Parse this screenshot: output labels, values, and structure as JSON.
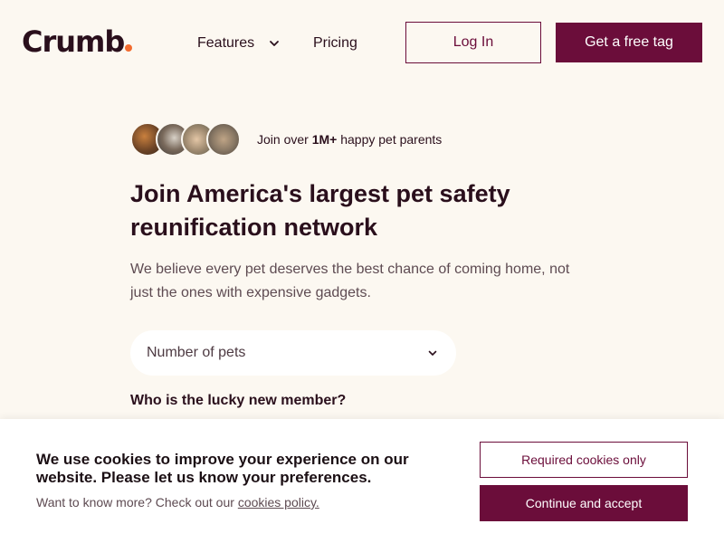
{
  "header": {
    "logo_text": "Crumb",
    "nav": {
      "features_label": "Features",
      "pricing_label": "Pricing"
    },
    "login_label": "Log In",
    "cta_label": "Get a free tag"
  },
  "hero": {
    "social_proof": {
      "prefix": "Join over ",
      "count": "1M+",
      "suffix": " happy pet parents"
    },
    "headline": "Join America's largest pet safety reunification network",
    "subtext": "We believe every pet deserves the best chance of coming home, not just the ones with expensive gadgets.",
    "pets_select": {
      "placeholder": "Number of pets"
    },
    "question": "Who is the lucky new member?"
  },
  "cookie_banner": {
    "title": "We use cookies to improve your experience on our website. Please let us know your preferences.",
    "more_prefix": "Want to know more? Check out our ",
    "policy_link": "cookies policy.",
    "required_label": "Required cookies only",
    "accept_label": "Continue and accept"
  },
  "colors": {
    "brand": "#6b0d3a",
    "logo_dot": "#f26b2f",
    "background": "#fcf8f1",
    "text": "#2a0f1c"
  },
  "icons": {
    "features_chevron": "chevron-down-icon",
    "select_chevron": "chevron-down-icon"
  }
}
